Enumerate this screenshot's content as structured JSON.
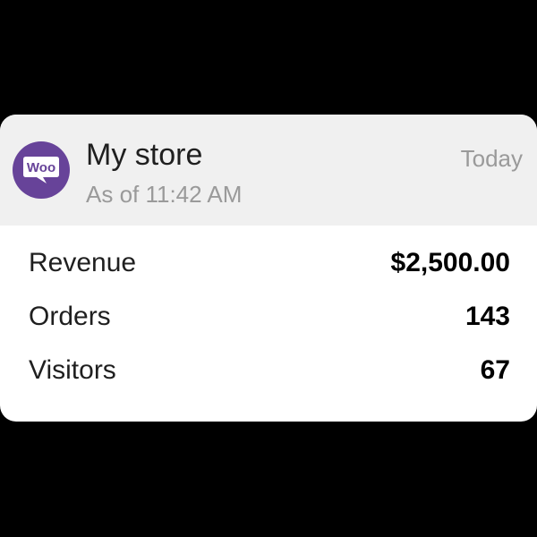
{
  "header": {
    "logo_icon": "woo-logo-icon",
    "logo_text": "Woo",
    "store_name": "My store",
    "as_of": "As of 11:42 AM",
    "date_range": "Today"
  },
  "stats": [
    {
      "label": "Revenue",
      "value": "$2,500.00"
    },
    {
      "label": "Orders",
      "value": "143"
    },
    {
      "label": "Visitors",
      "value": "67"
    }
  ],
  "colors": {
    "brand_purple": "#674399",
    "header_bg": "#f0f0f0",
    "card_bg": "#ffffff",
    "muted_text": "#9a9a9a"
  }
}
